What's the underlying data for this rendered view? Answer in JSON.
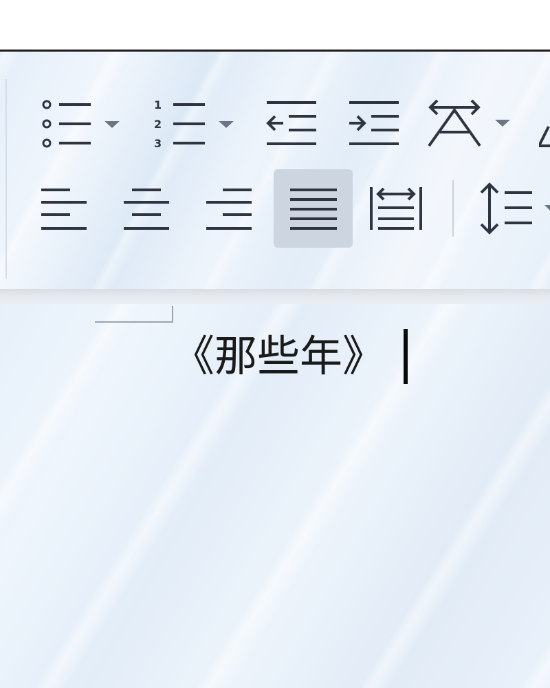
{
  "ribbon": {
    "row1": [
      {
        "name": "bullet-list-icon",
        "has_dropdown": true
      },
      {
        "name": "numbered-list-icon",
        "has_dropdown": true
      },
      {
        "name": "decrease-indent-icon",
        "has_dropdown": false
      },
      {
        "name": "increase-indent-icon",
        "has_dropdown": false
      },
      {
        "name": "text-direction-icon",
        "has_dropdown": true
      }
    ],
    "row2": [
      {
        "name": "align-left-icon",
        "active": false
      },
      {
        "name": "align-center-icon",
        "active": false
      },
      {
        "name": "align-right-icon",
        "active": true
      },
      {
        "name": "justify-icon",
        "active": true
      },
      {
        "name": "distributed-align-icon",
        "active": false
      },
      {
        "name": "line-spacing-icon",
        "active": false
      }
    ],
    "numbered_list_glyphs": [
      "1",
      "2",
      "3"
    ]
  },
  "document": {
    "title_text": "《那些年》"
  },
  "colors": {
    "icon": "#2e3440",
    "dropdown_arrow": "#6b7684",
    "active_button_bg": "#cdd6e0",
    "text": "#1a1a1a"
  }
}
